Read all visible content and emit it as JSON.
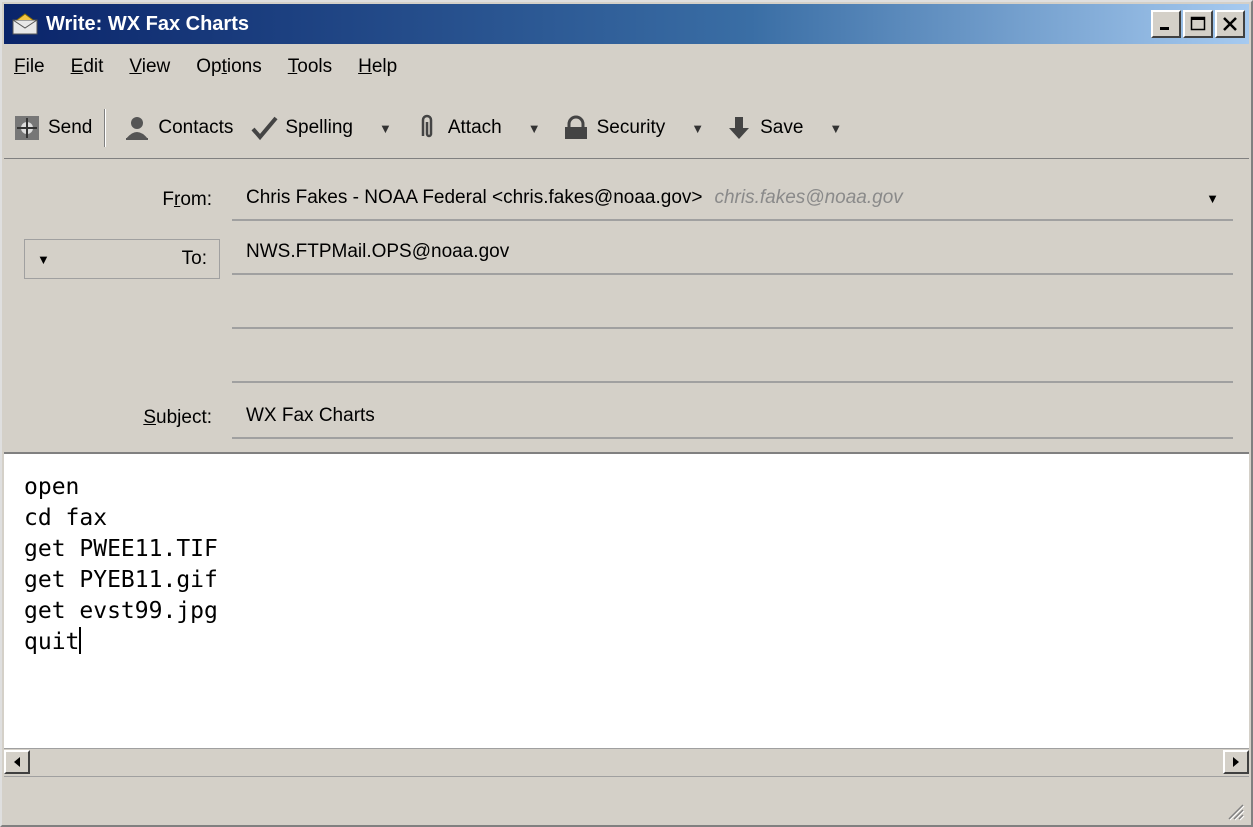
{
  "window": {
    "title": "Write: WX Fax Charts",
    "controls": {
      "minimize": "_",
      "maximize": "□",
      "close": "X"
    }
  },
  "menu": {
    "items": [
      {
        "key": "F",
        "rest": "ile"
      },
      {
        "key": "E",
        "rest": "dit"
      },
      {
        "key": "V",
        "rest": "iew"
      },
      {
        "pre": "Op",
        "key": "t",
        "rest": "ions"
      },
      {
        "key": "T",
        "rest": "ools"
      },
      {
        "key": "H",
        "rest": "elp"
      }
    ]
  },
  "toolbar": {
    "send": "Send",
    "contacts": "Contacts",
    "spelling": "Spelling",
    "attach": "Attach",
    "security": "Security",
    "save": "Save",
    "dropdown_glyph": "▼"
  },
  "header": {
    "from_label_pre": "F",
    "from_label_key": "r",
    "from_label_post": "om:",
    "from_value": "Chris Fakes - NOAA Federal <chris.fakes@noaa.gov>",
    "from_identity": "chris.fakes@noaa.gov",
    "to_label": "To:",
    "to_value": "NWS.FTPMail.OPS@noaa.gov",
    "subject_label_key": "S",
    "subject_label_rest": "ubject:",
    "subject_value": "WX Fax Charts"
  },
  "body": {
    "lines": [
      "open",
      "cd fax",
      "get PWEE11.TIF",
      "get PYEB11.gif",
      "get evst99.jpg",
      "quit"
    ]
  },
  "colors": {
    "title_bar": "#0a246a",
    "chrome": "#d4d0c8",
    "muted_text": "#8a8a8a"
  }
}
